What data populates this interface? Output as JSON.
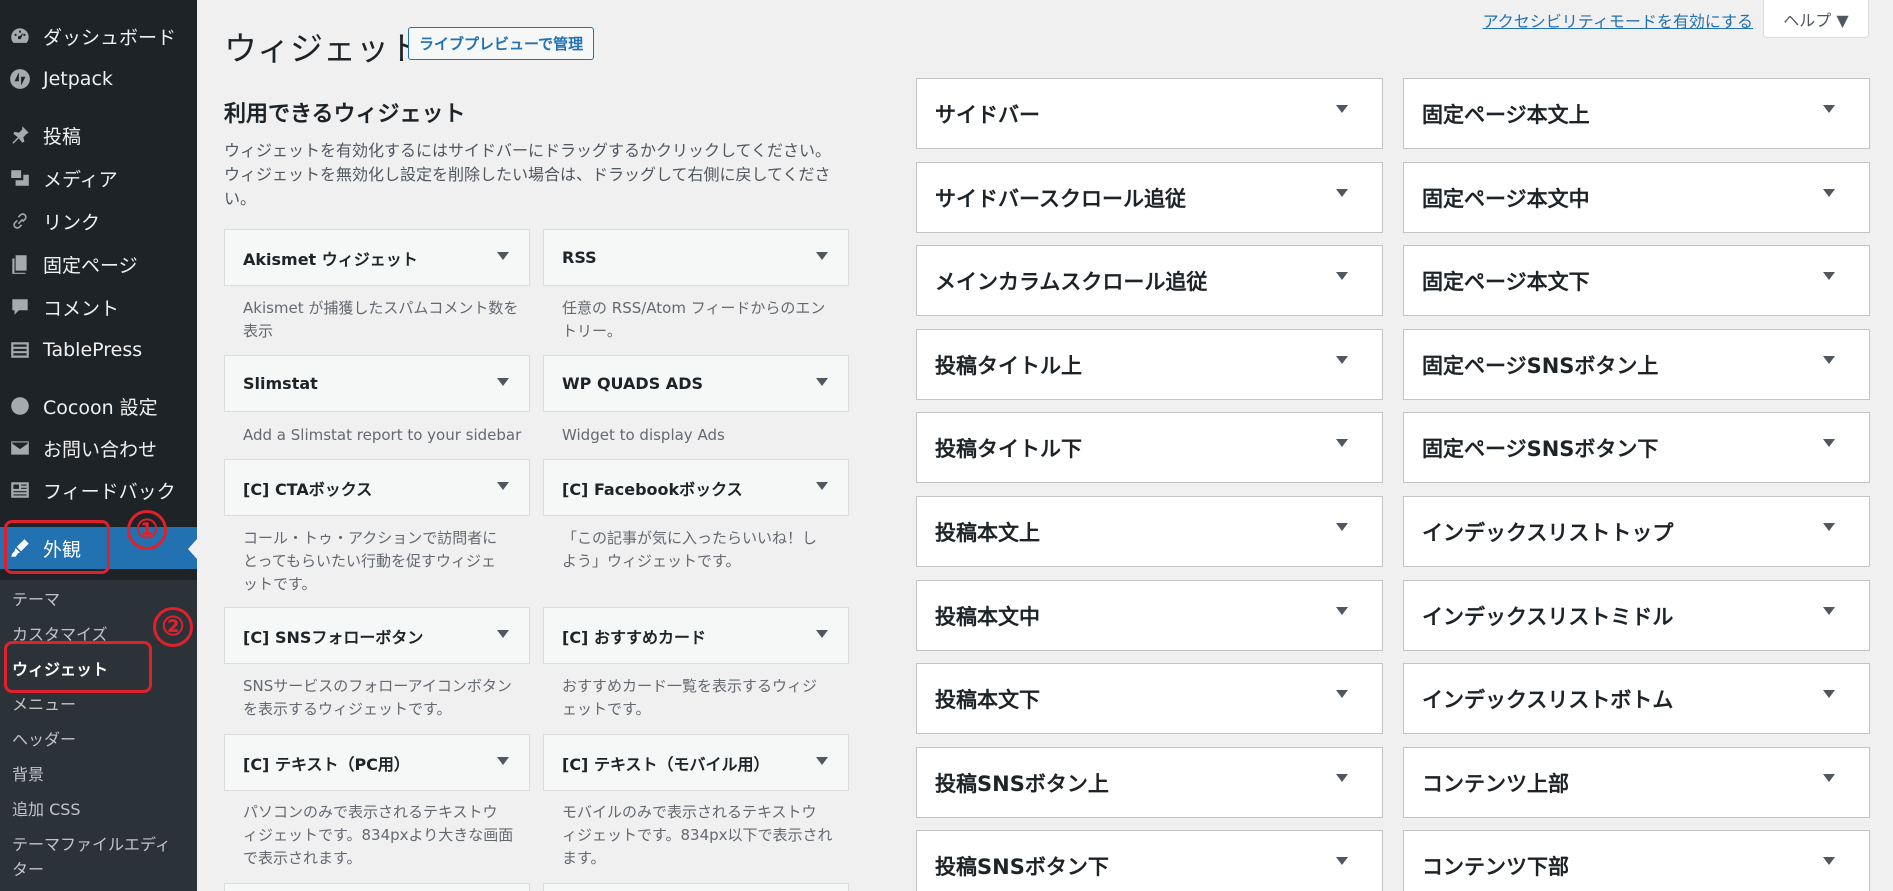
{
  "sidebar": {
    "items": [
      {
        "label": "ダッシュボード",
        "icon": "dashboard-icon"
      },
      {
        "label": "Jetpack",
        "icon": "jetpack-icon"
      },
      {
        "label": "投稿",
        "icon": "pin-icon"
      },
      {
        "label": "メディア",
        "icon": "media-icon"
      },
      {
        "label": "リンク",
        "icon": "link-icon"
      },
      {
        "label": "固定ページ",
        "icon": "page-icon"
      },
      {
        "label": "コメント",
        "icon": "comment-icon"
      },
      {
        "label": "TablePress",
        "icon": "table-icon"
      },
      {
        "label": "Cocoon 設定",
        "icon": "circle-icon"
      },
      {
        "label": "お問い合わせ",
        "icon": "mail-icon"
      },
      {
        "label": "フィードバック",
        "icon": "feedback-icon"
      },
      {
        "label": "外観",
        "icon": "brush-icon"
      }
    ],
    "submenu": [
      "テーマ",
      "カスタマイズ",
      "ウィジェット",
      "メニュー",
      "ヘッダー",
      "背景",
      "追加 CSS",
      "テーマファイルエディ",
      "ター"
    ]
  },
  "annotations": {
    "num1": "①",
    "num2": "②",
    "color": "#e0202a"
  },
  "header": {
    "title": "ウィジェット",
    "live_preview": "ライブプレビューで管理",
    "accessibility_link": "アクセシビリティモードを有効にする",
    "help": "ヘルプ ▼"
  },
  "available": {
    "title": "利用できるウィジェット",
    "desc1": "ウィジェットを有効化するにはサイドバーにドラッグするかクリックしてください。",
    "desc2": "ウィジェットを無効化し設定を削除したい場合は、ドラッグして右側に戻してくださ",
    "desc3": "い。",
    "widgets": [
      {
        "name": "Akismet ウィジェット",
        "desc": [
          "Akismet が捕獲したスパムコメント数を",
          "表示"
        ]
      },
      {
        "name": "RSS",
        "desc": [
          "任意の RSS/Atom フィードからのエン",
          "トリー。"
        ]
      },
      {
        "name": "Slimstat",
        "desc": [
          "Add a Slimstat report to your sidebar"
        ]
      },
      {
        "name": "WP QUADS ADS",
        "desc": [
          "Widget to display Ads"
        ]
      },
      {
        "name": "[C] CTAボックス",
        "desc": [
          "コール・トゥ・アクションで訪問者に",
          "とってもらいたい行動を促すウィジェ",
          "ットです。"
        ]
      },
      {
        "name": "[C] Facebookボックス",
        "desc": [
          "「この記事が気に入ったらいいね！し",
          "よう」ウィジェットです。"
        ]
      },
      {
        "name": "[C] SNSフォローボタン",
        "desc": [
          "SNSサービスのフォローアイコンボタン",
          "を表示するウィジェットです。"
        ]
      },
      {
        "name": "[C] おすすめカード",
        "desc": [
          "おすすめカード一覧を表示するウィジ",
          "ェットです。"
        ]
      },
      {
        "name": "[C] テキスト（PC用）",
        "desc": [
          "パソコンのみで表示されるテキストウ",
          "ィジェットです。834pxより大きな画面",
          "で表示されます。"
        ]
      },
      {
        "name": "[C] テキスト（モバイル用）",
        "desc": [
          "モバイルのみで表示されるテキストウ",
          "ィジェットです。834px以下で表示され",
          "ます。"
        ]
      }
    ]
  },
  "areas": {
    "col1": [
      "サイドバー",
      "サイドバースクロール追従",
      "メインカラムスクロール追従",
      "投稿タイトル上",
      "投稿タイトル下",
      "投稿本文上",
      "投稿本文中",
      "投稿本文下",
      "投稿SNSボタン上",
      "投稿SNSボタン下"
    ],
    "col2": [
      "固定ページ本文上",
      "固定ページ本文中",
      "固定ページ本文下",
      "固定ページSNSボタン上",
      "固定ページSNSボタン下",
      "インデックスリストトップ",
      "インデックスリストミドル",
      "インデックスリストボトム",
      "コンテンツ上部",
      "コンテンツ下部"
    ]
  },
  "colors": {
    "sidebar_bg": "#1d2327",
    "accent": "#2271b1",
    "page_bg": "#f0f0f1"
  }
}
